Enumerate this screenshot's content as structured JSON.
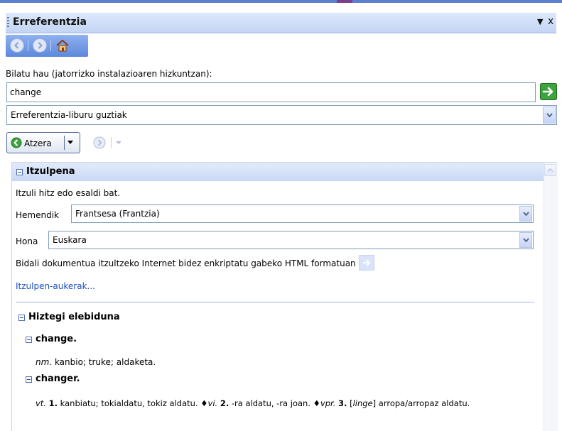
{
  "window": {
    "title": "Erreferentzia",
    "menu_glyph": "▼",
    "close_glyph": "x"
  },
  "navigation": {
    "icons": [
      "back-circle-icon",
      "forward-circle-icon",
      "home-icon"
    ]
  },
  "search": {
    "label": "Bilatu hau (jatorrizko instalazioaren hizkuntzan):",
    "value": "change",
    "go_icon": "green-arrow-right-icon"
  },
  "scope_select": {
    "selected": "Erreferentzia-liburu guztiak"
  },
  "history": {
    "back_label": "Atzera"
  },
  "translation": {
    "heading": "Itzulpena",
    "instruction": "Itzuli hitz edo esaldi bat.",
    "from_label": "Hemendik",
    "from_value": "Frantsesa (Frantzia)",
    "to_label": "Hona",
    "to_value": "Euskara",
    "send_text": "Bidali dokumentua itzultzeko Internet bidez enkriptatu gabeko HTML formatuan",
    "options_link": "Itzulpen-aukerak..."
  },
  "dictionary": {
    "heading": "Hiztegi elebiduna",
    "entries": [
      {
        "headword": "change.",
        "pos": "nm.",
        "definition": "kanbio; truke; aldaketa."
      },
      {
        "headword": "changer.",
        "pos1": "vt.",
        "n1": "1.",
        "def1": "kanbiatu; tokialdatu, tokiz aldatu.",
        "pos2": "vi.",
        "n2": "2.",
        "def2": "-ra aldatu, -ra joan.",
        "pos3": "vpr.",
        "n3": "3.",
        "tag3": "linge",
        "def3": "arropa/arropaz aldatu.",
        "bullet": "♦"
      }
    ]
  },
  "colors": {
    "accent": "#5d88db",
    "header_bg": "#c9d9f5",
    "link": "#1f4fc0",
    "go_green": "#2f9a2f"
  }
}
